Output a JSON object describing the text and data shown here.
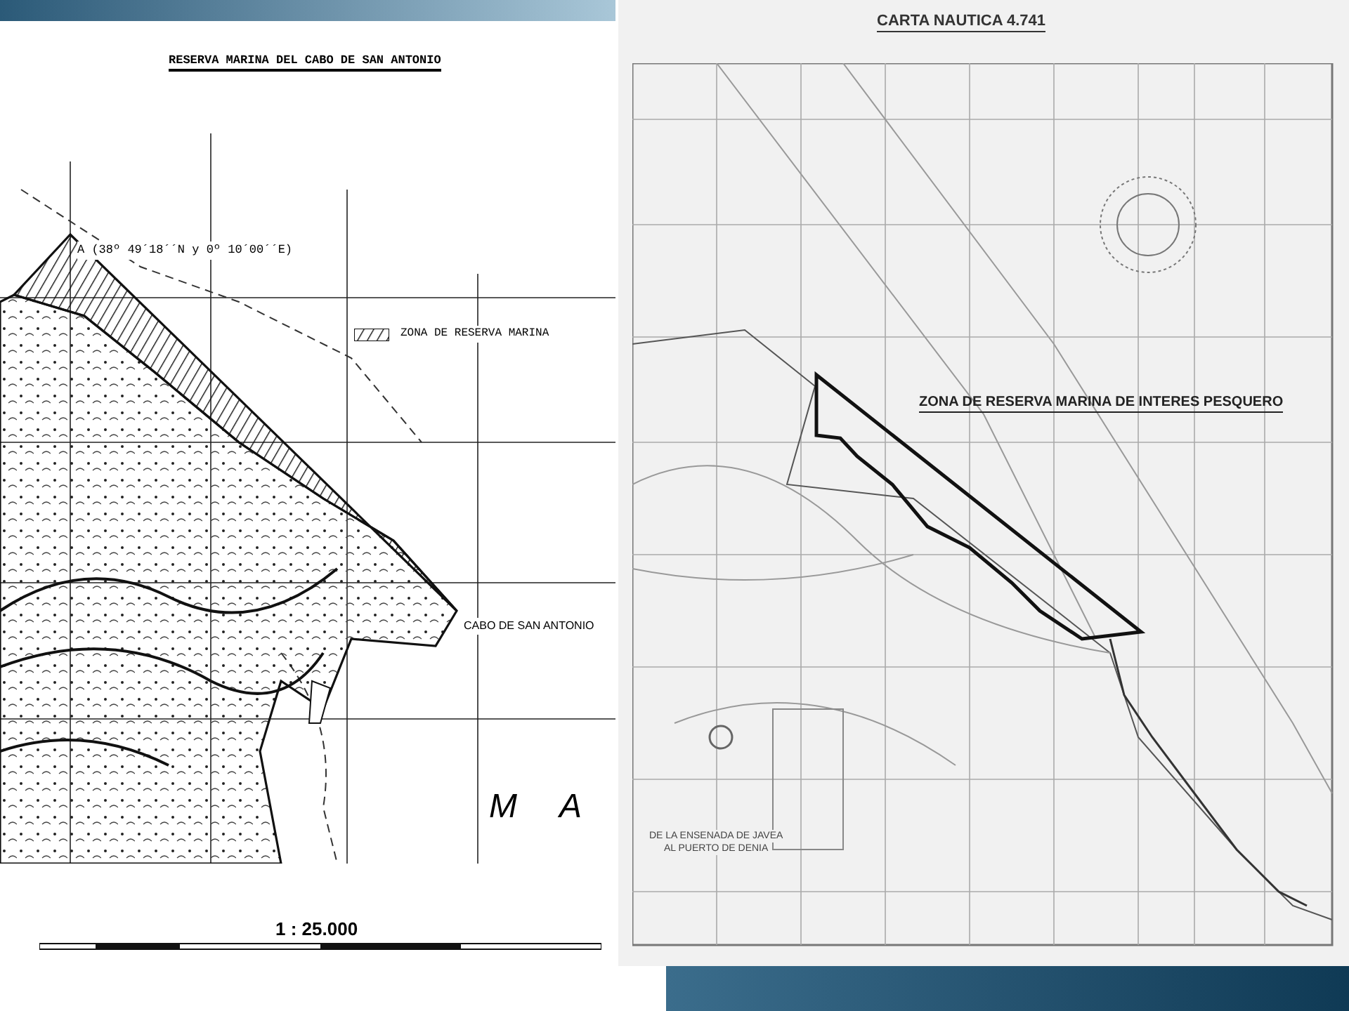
{
  "left_map": {
    "title": "RESERVA MARINA DEL CABO DE SAN ANTONIO",
    "point_label": "A (38º 49´18´´N y 0º 10´00´´E)",
    "legend_label": "ZONA DE RESERVA MARINA",
    "place_label": "CABO DE SAN ANTONIO",
    "sea_letters": [
      "M",
      "A"
    ],
    "scale": "1 : 25.000"
  },
  "right_map": {
    "title": "CARTA NAUTICA 4.741",
    "zone_label": "ZONA DE RESERVA MARINA DE INTERES PESQUERO",
    "legend_lines": [
      "DE LA ENSENADA DE JAVEA",
      "AL PUERTO DE DENIA"
    ]
  }
}
